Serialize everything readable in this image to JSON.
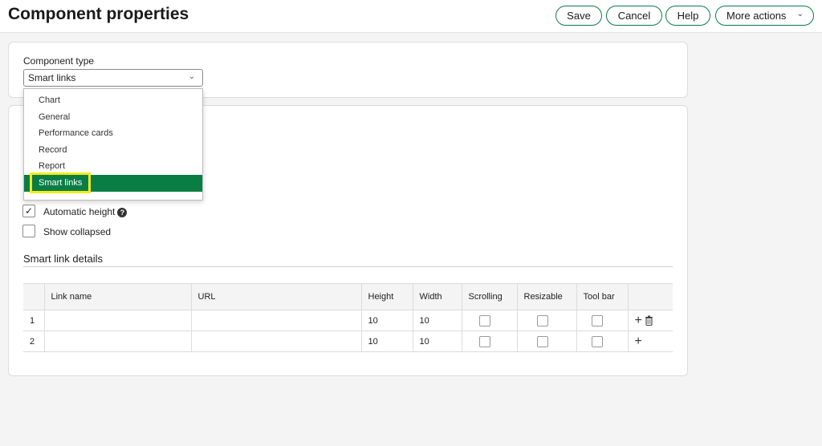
{
  "header": {
    "title": "Component properties",
    "buttons": {
      "save": "Save",
      "cancel": "Cancel",
      "help": "Help",
      "more_actions": "More actions"
    }
  },
  "component_type": {
    "label": "Component type",
    "value": "Smart links",
    "options": [
      "Chart",
      "General",
      "Performance cards",
      "Record",
      "Report",
      "Smart links"
    ],
    "selected": "Smart links"
  },
  "options": {
    "automatic_height": {
      "label": "Automatic height",
      "checked": true,
      "help": "?"
    },
    "show_collapsed": {
      "label": "Show collapsed",
      "checked": false
    }
  },
  "smart_link_details": {
    "title": "Smart link details",
    "columns": [
      "",
      "Link name",
      "URL",
      "Height",
      "Width",
      "Scrolling",
      "Resizable",
      "Tool bar",
      ""
    ],
    "rows": [
      {
        "num": "1",
        "link_name": "",
        "url": "",
        "height": "10",
        "width": "10",
        "scrolling": false,
        "resizable": false,
        "toolbar": false
      },
      {
        "num": "2",
        "link_name": "",
        "url": "",
        "height": "10",
        "width": "10",
        "scrolling": false,
        "resizable": false,
        "toolbar": false
      }
    ]
  },
  "icons": {
    "more_actions_chevron": "chevron-down-icon",
    "select_chevron": "chevron-down-icon",
    "add_row": "plus-icon",
    "delete_row": "trash-icon",
    "help": "question-circle-icon"
  },
  "colors": {
    "accent": "#0a7d45",
    "highlight": "#f3ea1c"
  }
}
